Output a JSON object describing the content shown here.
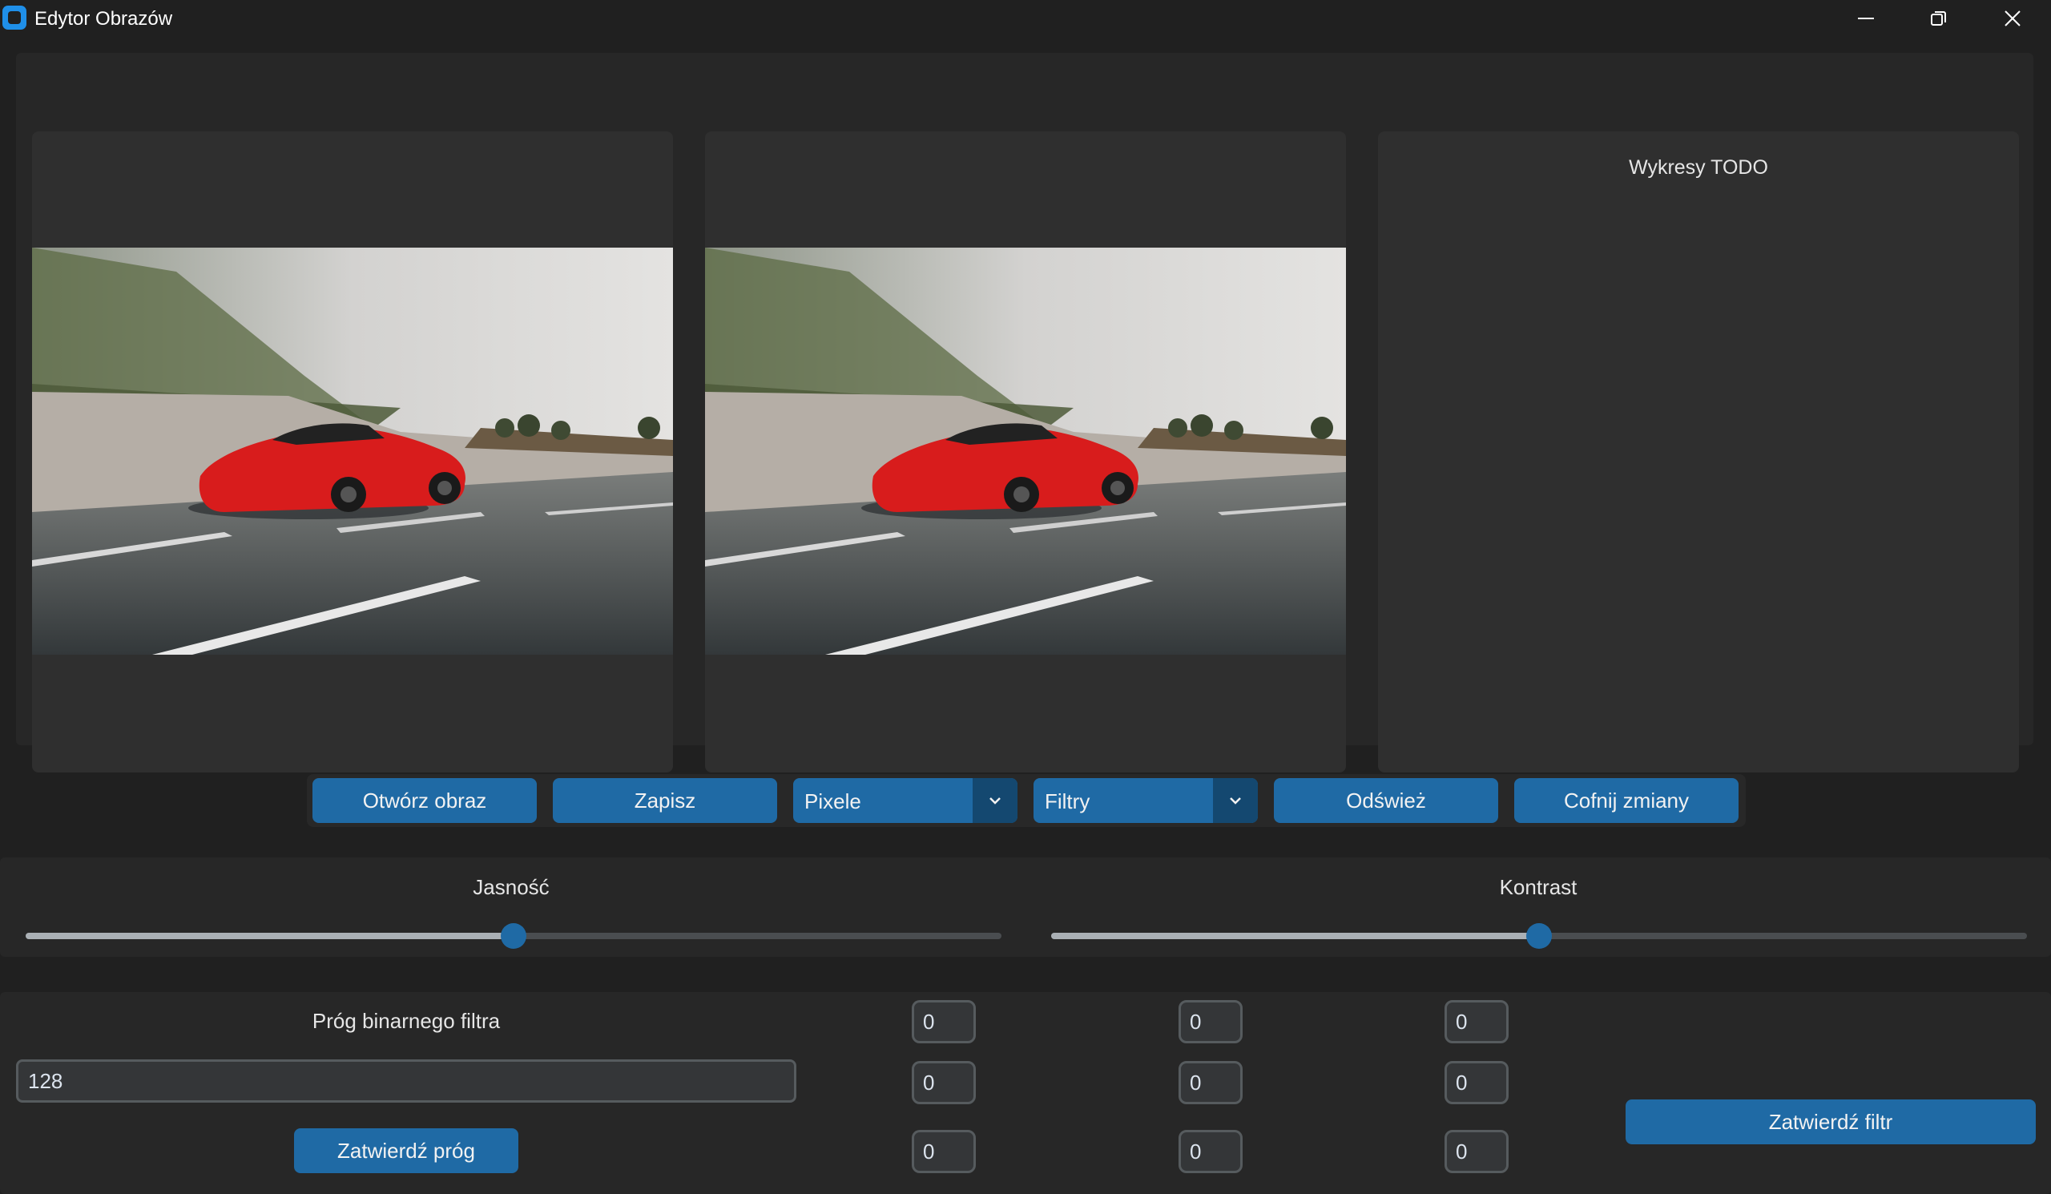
{
  "window": {
    "title": "Edytor Obrazów",
    "controls": [
      "minimize-icon",
      "restore-icon",
      "close-icon"
    ]
  },
  "panels": {
    "charts_placeholder": "Wykresy TODO"
  },
  "toolbar": {
    "open_label": "Otwórz obraz",
    "save_label": "Zapisz",
    "pixels_selected": "Pixele",
    "filters_selected": "Filtry",
    "refresh_label": "Odśwież",
    "undo_label": "Cofnij zmiany"
  },
  "sliders": {
    "brightness": {
      "label": "Jasność",
      "value_fraction": 0.5
    },
    "contrast": {
      "label": "Kontrast",
      "value_fraction": 0.5
    }
  },
  "threshold": {
    "label": "Próg binarnego filtra",
    "value": "128",
    "apply_label": "Zatwierdź próg"
  },
  "kernel": {
    "rows": [
      [
        "0",
        "0",
        "0"
      ],
      [
        "0",
        "0",
        "0"
      ],
      [
        "0",
        "0",
        "0"
      ]
    ],
    "apply_label": "Zatwierdź filtr"
  },
  "colors": {
    "accent": "#1f6aa5",
    "accent_dark": "#144870",
    "background": "#202020",
    "panel": "#2f2f2f"
  }
}
